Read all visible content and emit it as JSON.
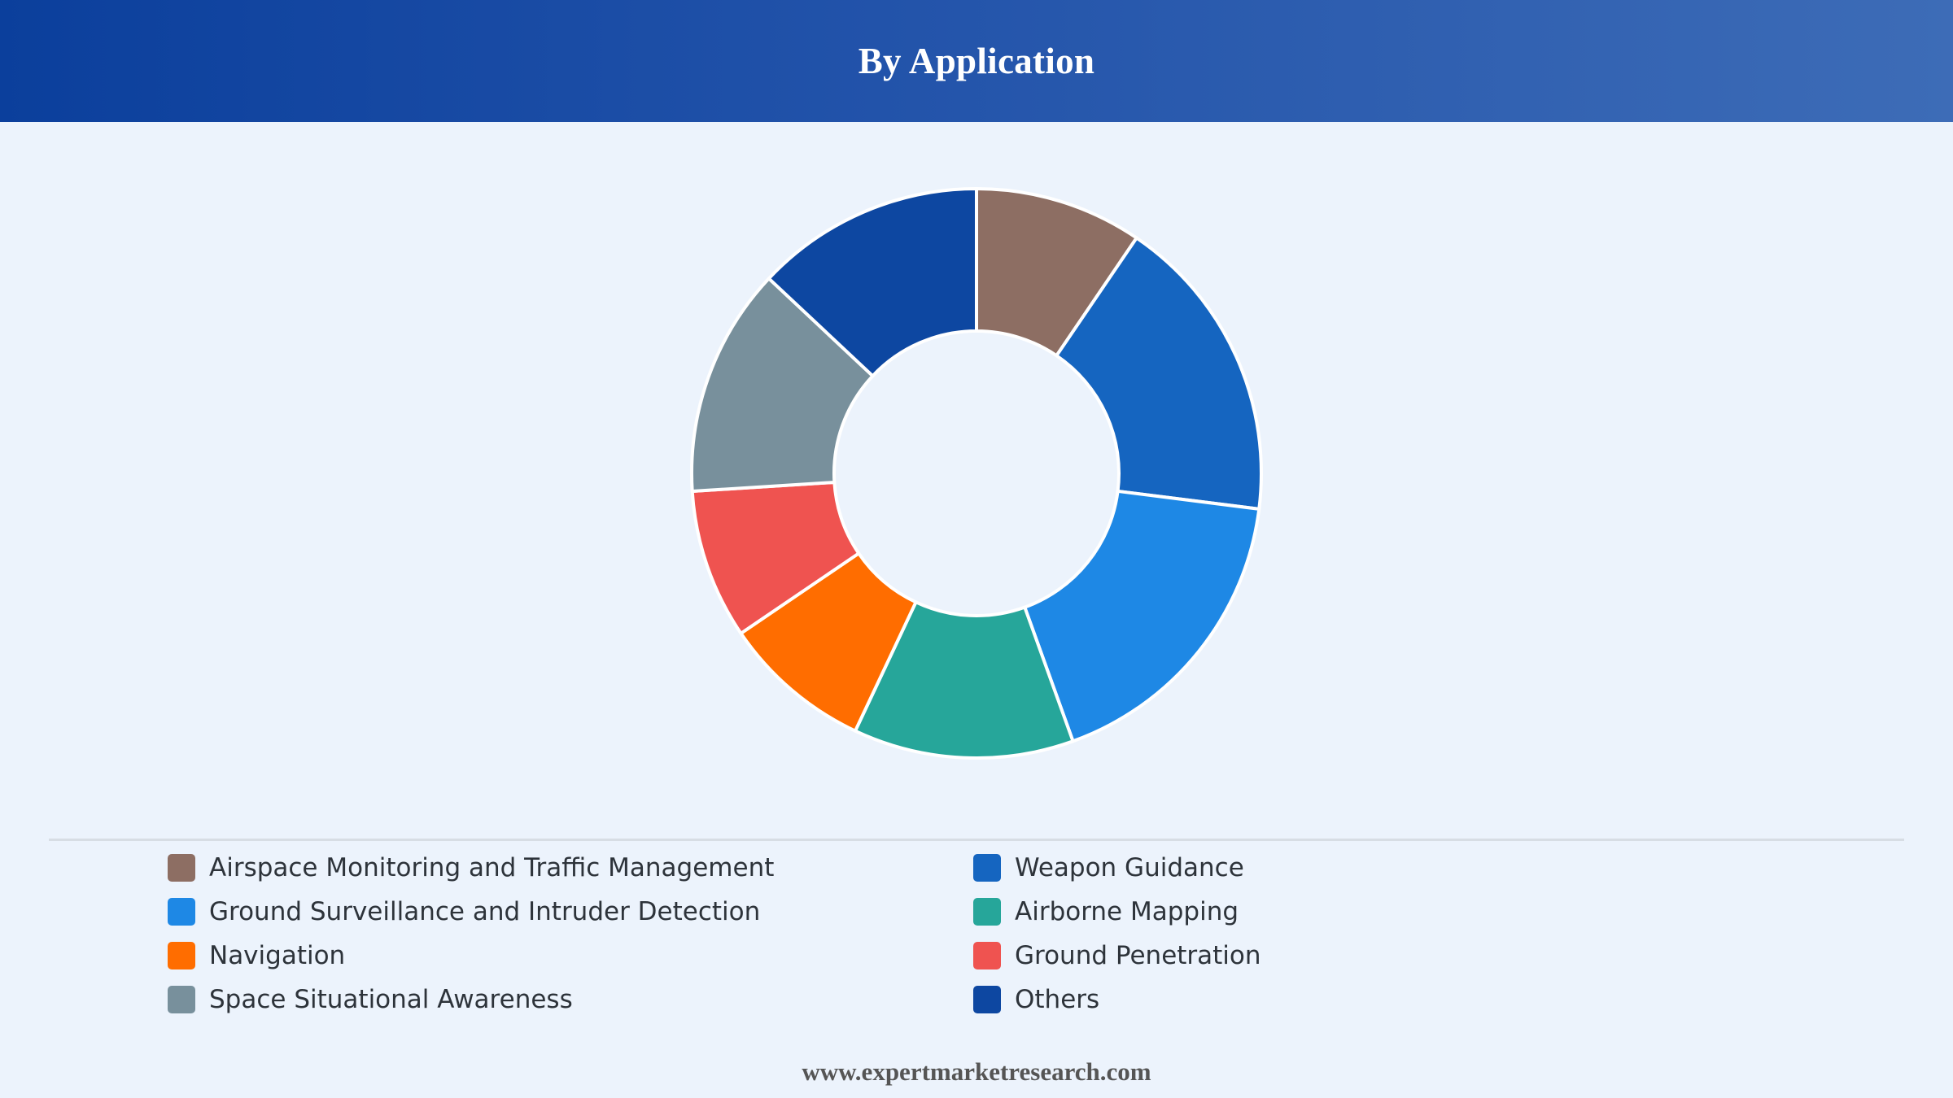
{
  "header": {
    "title": "By Application"
  },
  "chart_data": {
    "type": "pie",
    "variant": "donut",
    "title": "By Application",
    "categories": [
      "Airspace Monitoring and Traffic Management",
      "Weapon Guidance",
      "Ground Surveillance and Intruder Detection",
      "Airborne Mapping",
      "Navigation",
      "Ground Penetration",
      "Space Situational Awareness",
      "Others"
    ],
    "values": [
      9.5,
      17.5,
      17.5,
      12.5,
      8.5,
      8.5,
      13,
      13
    ],
    "colors": [
      "#8d6e63",
      "#1565c0",
      "#1e88e5",
      "#26a69a",
      "#ff6d00",
      "#ef5350",
      "#78909c",
      "#0d47a1"
    ],
    "legend_position": "bottom",
    "grid": false
  },
  "footer": {
    "text": "www.expertmarketresearch.com"
  }
}
